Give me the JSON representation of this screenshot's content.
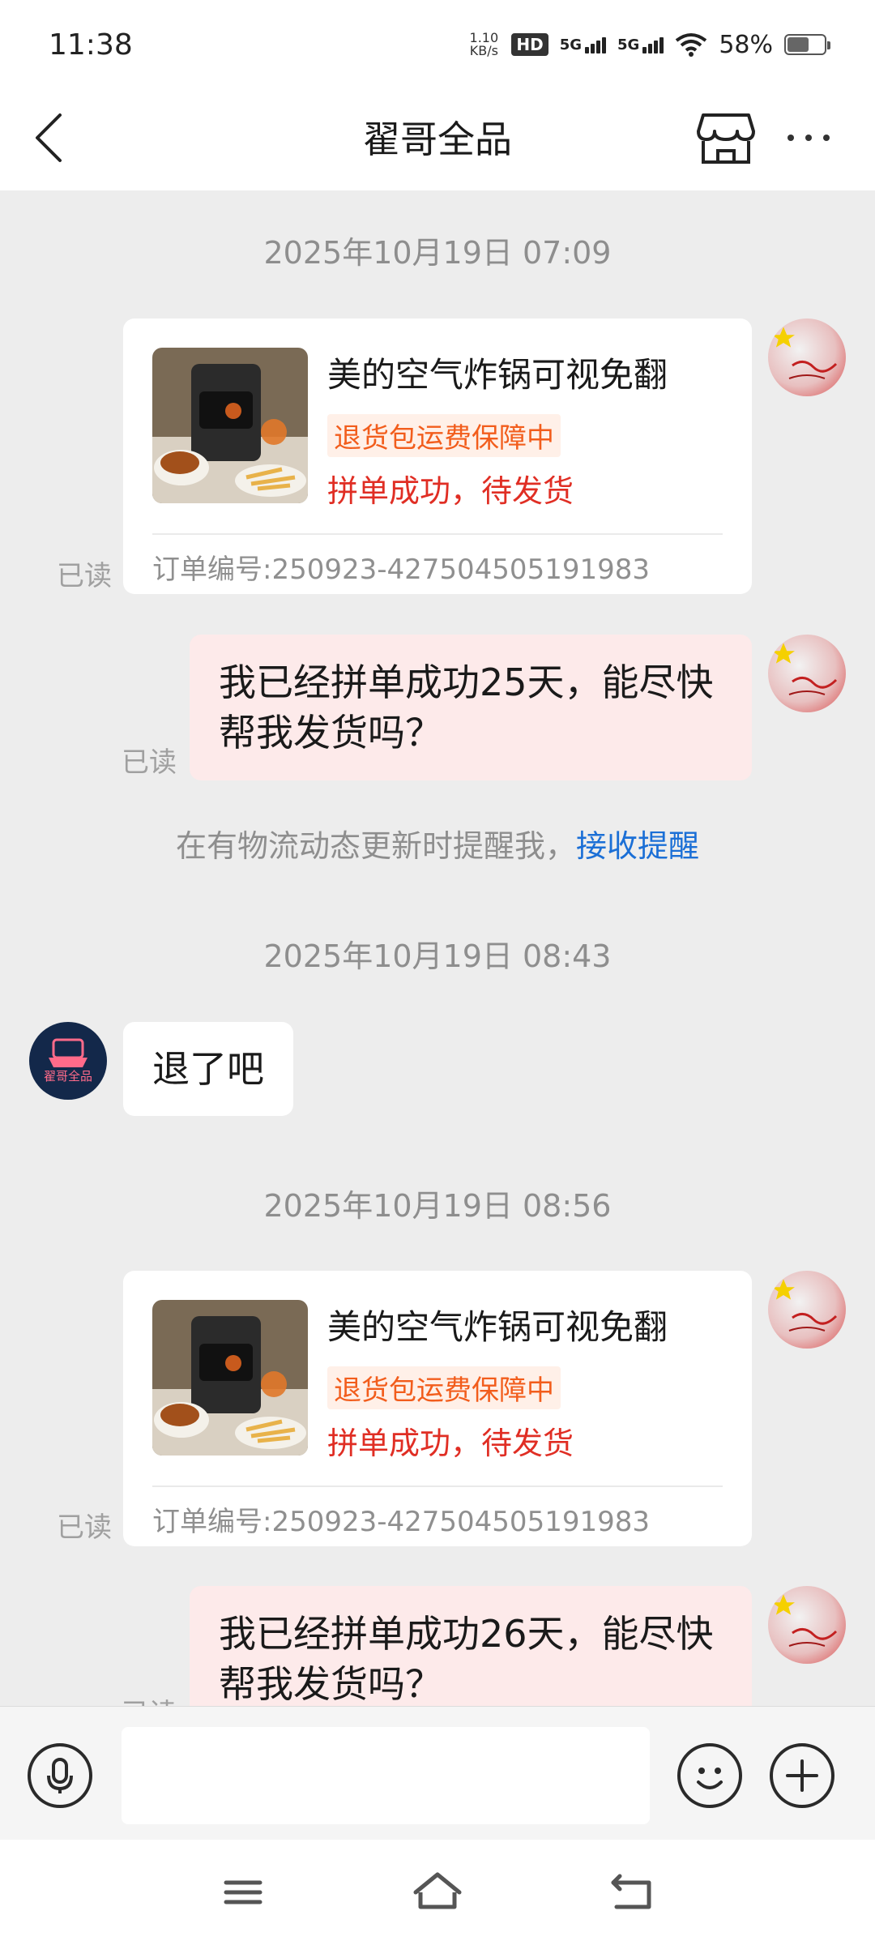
{
  "status_bar": {
    "time": "11:38",
    "net_speed_value": "1.10",
    "net_speed_unit": "KB/s",
    "hd_label": "HD",
    "network_1": "5G",
    "network_2": "5G",
    "battery_percent": "58%",
    "battery_level": 0.58
  },
  "header": {
    "title": "翟哥全品",
    "back_icon": "chevron-left-icon",
    "store_icon": "store-icon",
    "more_icon": "more-horizontal-icon"
  },
  "messages": [
    {
      "type": "timestamp",
      "text": "2025年10月19日 07:09"
    },
    {
      "type": "order_card",
      "from": "me",
      "product_title": "美的空气炸锅可视免翻",
      "tag": "退货包运费保障中",
      "status": "拼单成功，待发货",
      "order_no": "订单编号:250923-427504505191983",
      "read": "已读"
    },
    {
      "type": "text",
      "from": "me",
      "text": "我已经拼单成功25天，能尽快帮我发货吗？",
      "read": "已读"
    },
    {
      "type": "notice",
      "text": "在有物流动态更新时提醒我，",
      "link": "接收提醒"
    },
    {
      "type": "timestamp",
      "text": "2025年10月19日 08:43"
    },
    {
      "type": "text",
      "from": "shop",
      "text": "退了吧",
      "avatar_text": "翟哥全品"
    },
    {
      "type": "timestamp",
      "text": "2025年10月19日 08:56"
    },
    {
      "type": "order_card",
      "from": "me",
      "product_title": "美的空气炸锅可视免翻",
      "tag": "退货包运费保障中",
      "status": "拼单成功，待发货",
      "order_no": "订单编号:250923-427504505191983",
      "read": "已读"
    },
    {
      "type": "text",
      "from": "me",
      "text": "我已经拼单成功26天，能尽快帮我发货吗？",
      "read": "已读"
    }
  ],
  "input_bar": {
    "voice_icon": "microphone-icon",
    "placeholder": "",
    "emoji_icon": "smiley-icon",
    "plus_icon": "plus-circle-icon"
  },
  "nav_bar": {
    "menu_icon": "menu-icon",
    "home_icon": "home-icon",
    "back_icon": "back-icon"
  },
  "colors": {
    "sent_bubble": "#fdeaea",
    "tag_orange": "#f25d1c",
    "status_red": "#e02e24",
    "link_blue": "#1b6fd6",
    "background": "#ededed"
  }
}
